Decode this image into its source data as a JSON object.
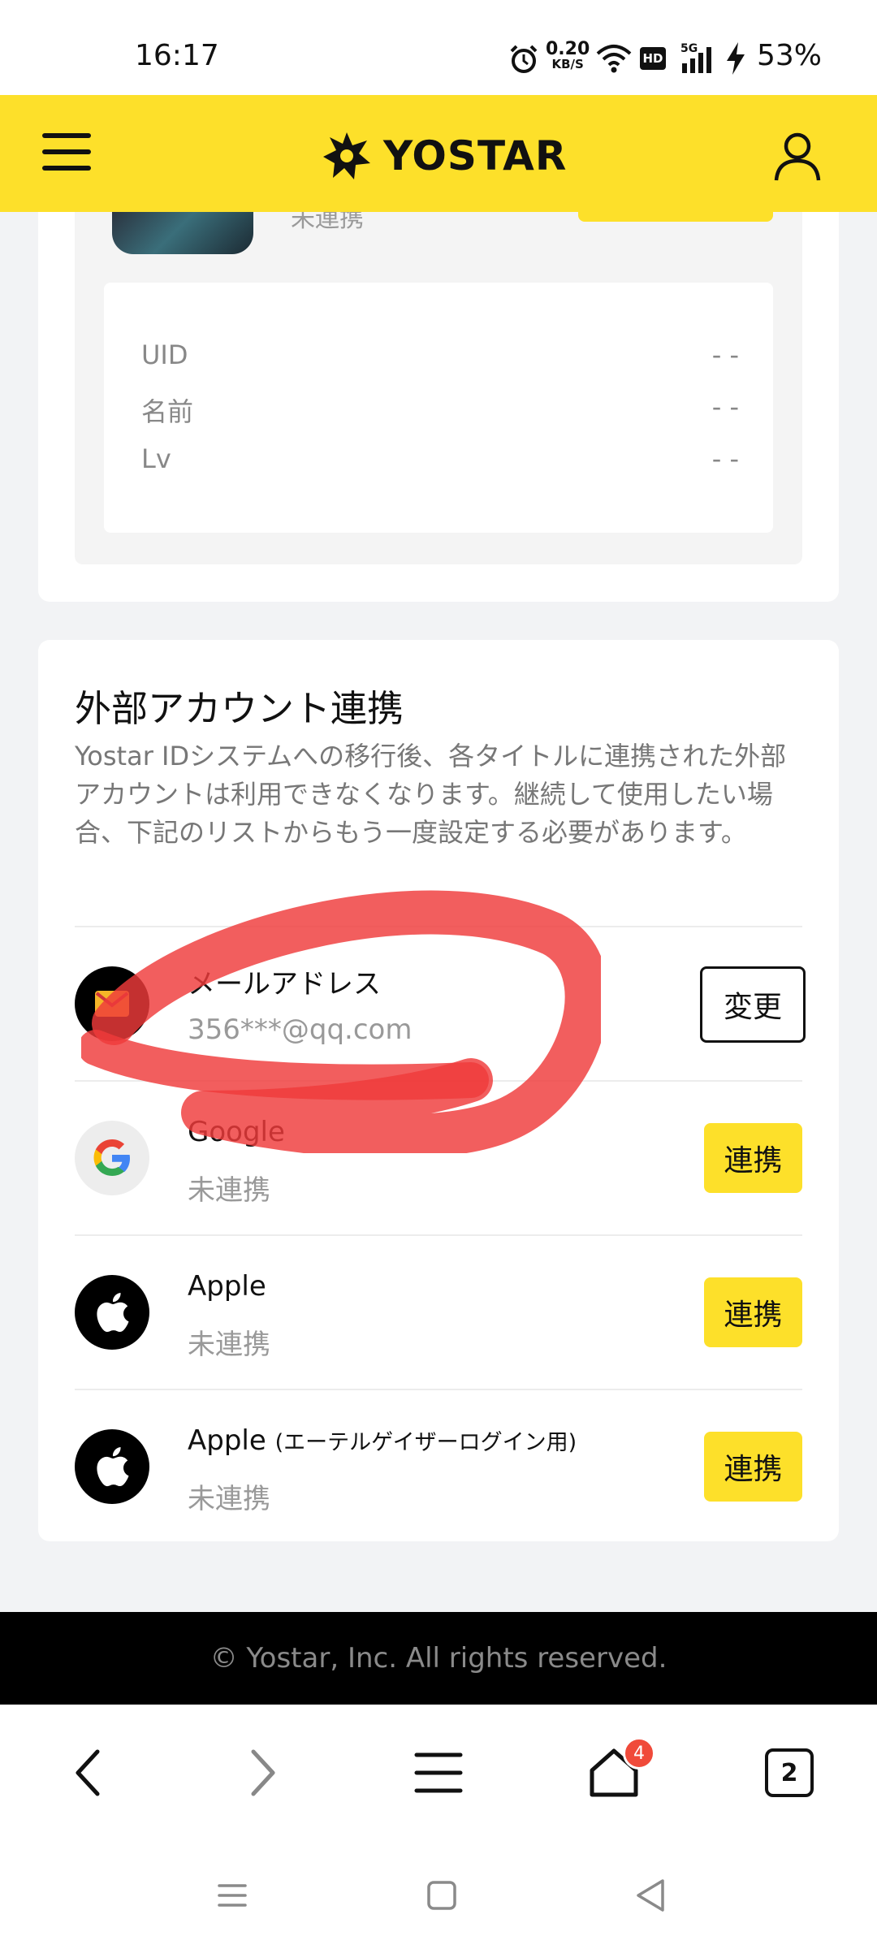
{
  "status_bar": {
    "time": "16:17",
    "net_speed_value": "0.20",
    "net_speed_unit": "KB/S",
    "hd_label": "HD",
    "network_label": "5G",
    "battery": "53%"
  },
  "header": {
    "logo_text": "YOSTAR"
  },
  "game_card": {
    "link_status": "未連携",
    "info_rows": [
      {
        "label": "UID",
        "value": "- -"
      },
      {
        "label": "名前",
        "value": "- -"
      },
      {
        "label": "Lv",
        "value": "- -"
      }
    ]
  },
  "external": {
    "title": "外部アカウント連携",
    "description": "Yostar IDシステムへの移行後、各タイトルに連携された外部アカウントは利用できなくなります。継続して使用したい場合、下記のリストからもう一度設定する必要があります。",
    "accounts": [
      {
        "name": "メールアドレス",
        "status": "356***@qq.com",
        "button": "変更",
        "icon": "mail-icon"
      },
      {
        "name": "Google",
        "status": "未連携",
        "button": "連携",
        "icon": "google-icon"
      },
      {
        "name": "Apple",
        "status": "未連携",
        "button": "連携",
        "icon": "apple-icon"
      },
      {
        "name": "Apple",
        "name_suffix": "(エーテルゲイザーログイン用)",
        "status": "未連携",
        "button": "連携",
        "icon": "apple-icon"
      }
    ]
  },
  "footer": {
    "copyright": "© Yostar, Inc. All rights reserved."
  },
  "browser_bar": {
    "home_badge": "4",
    "tab_count": "2"
  },
  "colors": {
    "brand_yellow": "#fde02a",
    "scribble_red": "#ef3b3b",
    "footer_bg": "#000000"
  }
}
